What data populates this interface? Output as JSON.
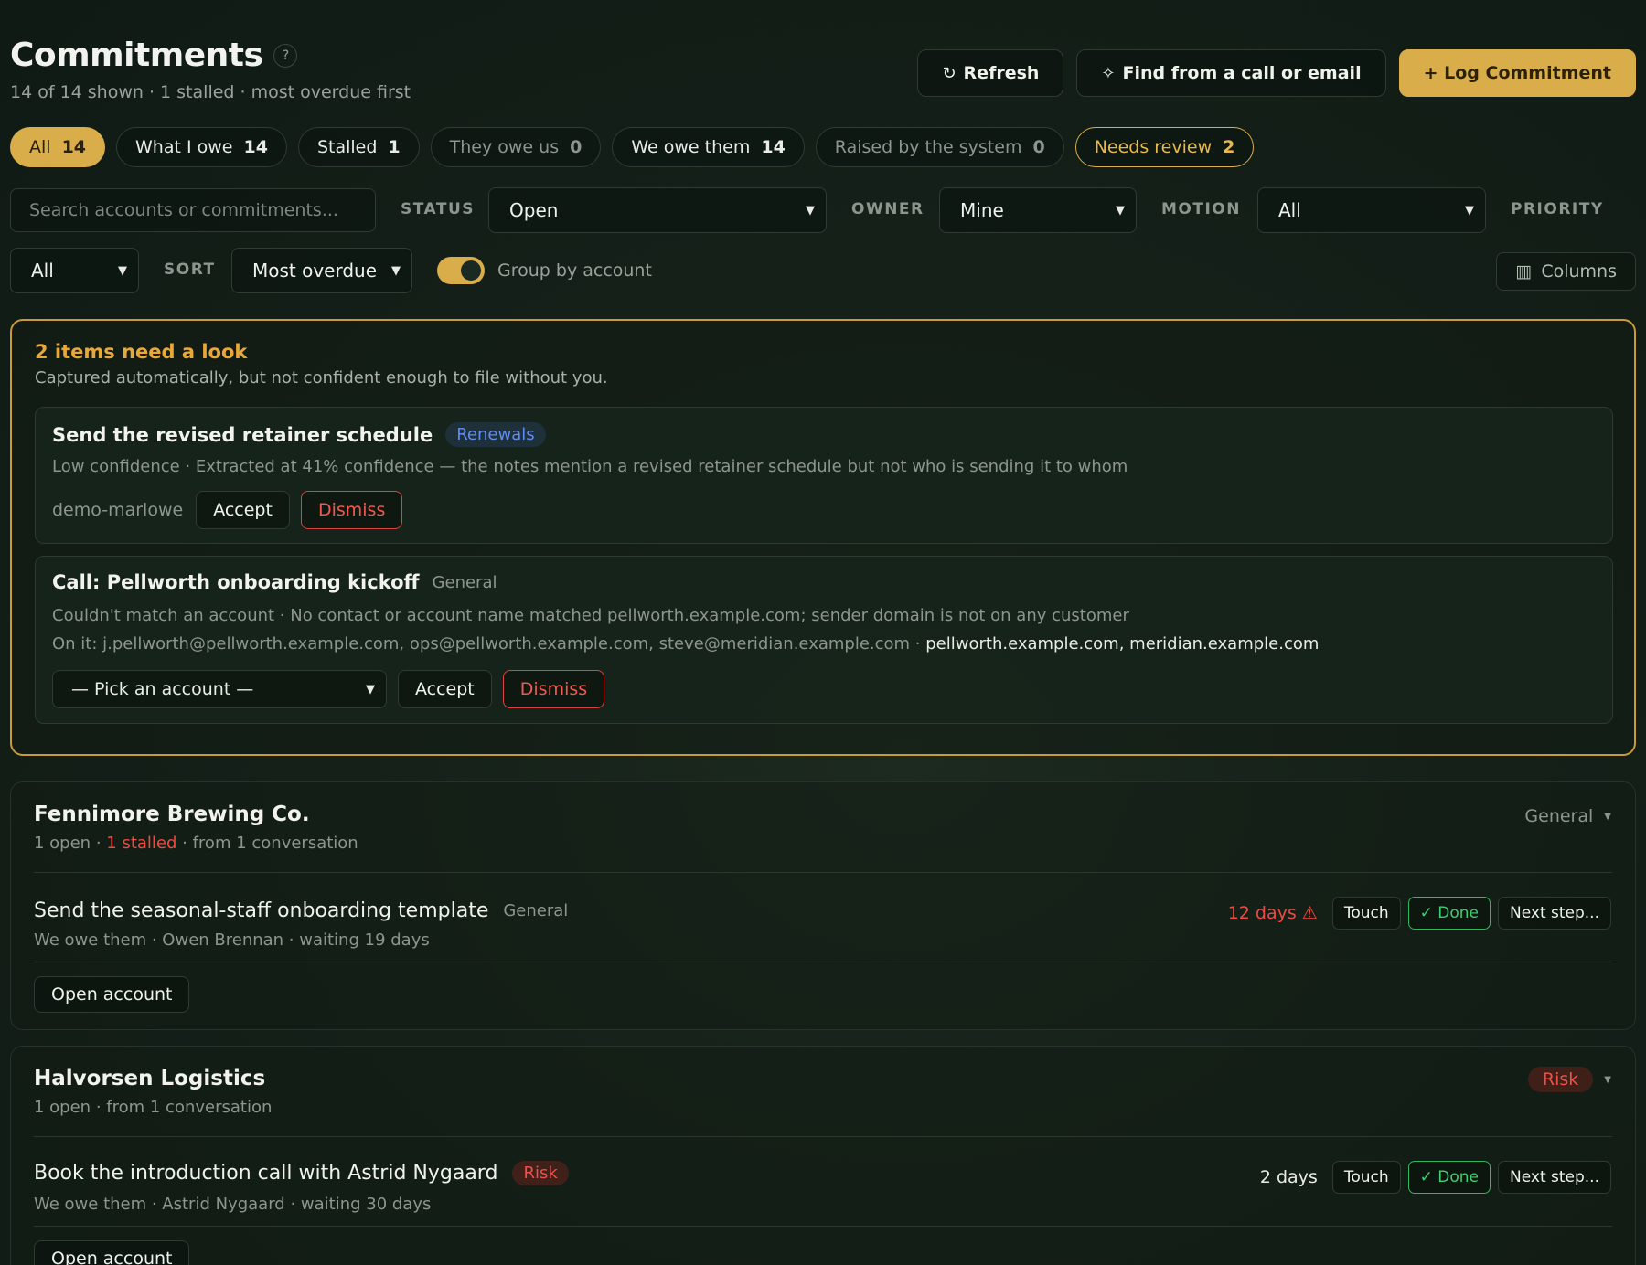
{
  "header": {
    "title": "Commitments",
    "help": "?",
    "subtitle": "14 of 14 shown · 1 stalled · most overdue first",
    "refresh_label": "Refresh",
    "find_label": "Find from a call or email",
    "log_label": "+ Log Commitment"
  },
  "pills": [
    {
      "label": "All",
      "count": "14"
    },
    {
      "label": "What I owe",
      "count": "14"
    },
    {
      "label": "Stalled",
      "count": "1"
    },
    {
      "label": "They owe us",
      "count": "0"
    },
    {
      "label": "We owe them",
      "count": "14"
    },
    {
      "label": "Raised by the system",
      "count": "0"
    },
    {
      "label": "Needs review",
      "count": "2"
    }
  ],
  "filters": {
    "search_placeholder": "Search accounts or commitments...",
    "status_label": "STATUS",
    "status_value": "Open",
    "owner_label": "OWNER",
    "owner_value": "Mine",
    "motion_label": "MOTION",
    "motion_value": "All",
    "priority_label": "PRIORITY",
    "priority_value": "All",
    "sort_label": "SORT",
    "sort_value": "Most overdue",
    "group_label": "Group by account",
    "columns_label": "Columns"
  },
  "review": {
    "title": "2 items need a look",
    "subtitle": "Captured automatically, but not confident enough to file without you.",
    "items": [
      {
        "title": "Send the revised retainer schedule",
        "tag": "Renewals",
        "line1": "Low confidence · Extracted at 41% confidence — the notes mention a revised retainer schedule but not who is sending it to whom",
        "owner": "demo-marlowe",
        "accept": "Accept",
        "dismiss": "Dismiss"
      },
      {
        "title": "Call: Pellworth onboarding kickoff",
        "tag": "General",
        "line1": "Couldn't match an account · No contact or account name matched pellworth.example.com; sender domain is not on any customer",
        "line2_prefix": "On it: j.pellworth@pellworth.example.com, ops@pellworth.example.com, steve@meridian.example.com · ",
        "line2_domains": "pellworth.example.com, meridian.example.com",
        "picker": "— Pick an account —",
        "accept": "Accept",
        "dismiss": "Dismiss"
      }
    ]
  },
  "groups": [
    {
      "name": "Fennimore Brewing Co.",
      "meta_open": "1 open · ",
      "meta_stalled": "1 stalled",
      "meta_rest": " · from 1 conversation",
      "motion": "General",
      "item": {
        "title": "Send the seasonal-staff onboarding template",
        "tag": "General",
        "meta": "We owe them · Owen Brennan · waiting 19 days",
        "due": "12 days ⚠",
        "touch": "Touch",
        "done": "✓ Done",
        "next": "Next step..."
      },
      "open_label": "Open account"
    },
    {
      "name": "Halvorsen Logistics",
      "meta_open": "1 open · from 1 conversation",
      "motion": "Risk",
      "item": {
        "title": "Book the introduction call with Astrid Nygaard",
        "tag": "Risk",
        "meta": "We owe them · Astrid Nygaard · waiting 30 days",
        "due": "2 days",
        "touch": "Touch",
        "done": "✓ Done",
        "next": "Next step..."
      },
      "open_label": "Open account"
    }
  ],
  "colors": {
    "accent": "#d8ad4a",
    "danger": "#ef4a40",
    "success": "#3fcf73",
    "link_blue": "#5f8cf0"
  }
}
